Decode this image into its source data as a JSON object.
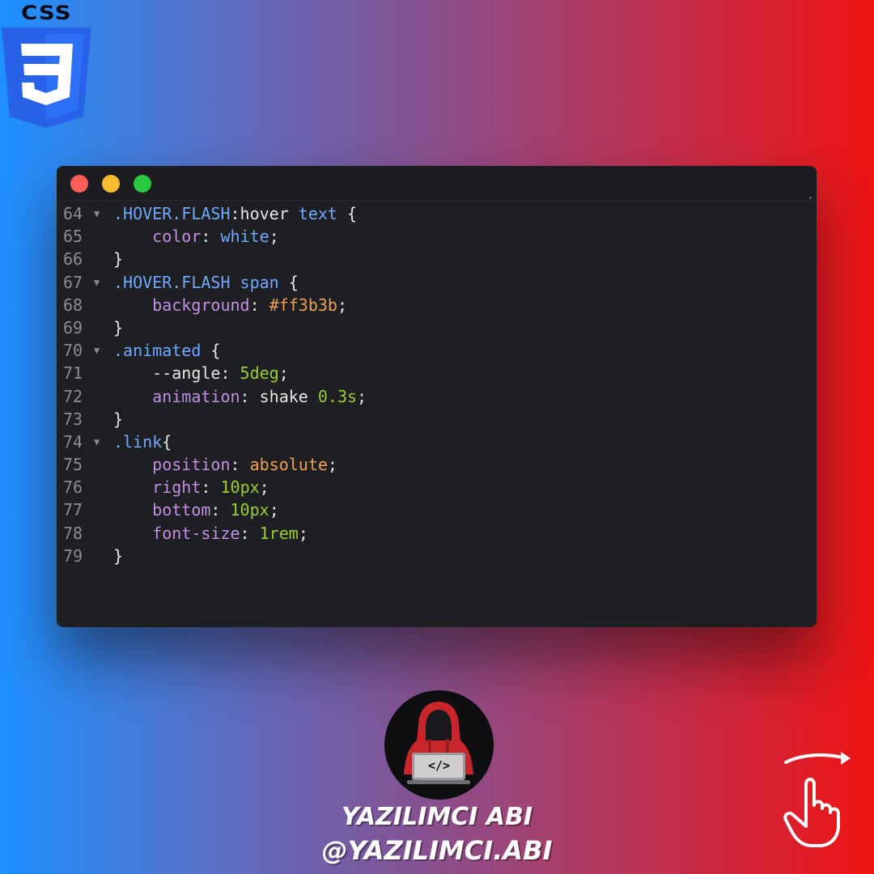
{
  "logo": {
    "word": "CSS",
    "digit": "3"
  },
  "window": {
    "controls": [
      "close",
      "minimize",
      "maximize"
    ],
    "lines": [
      {
        "num": "64",
        "fold": true,
        "tokens": [
          [
            "sel",
            ".HOVER.FLASH"
          ],
          [
            "pseudo",
            ":hover"
          ],
          [
            "plain",
            " "
          ],
          [
            "sel",
            "text"
          ],
          [
            "plain",
            " {"
          ]
        ]
      },
      {
        "num": "65",
        "fold": false,
        "tokens": [
          [
            "plain",
            "    "
          ],
          [
            "prop",
            "color"
          ],
          [
            "plain",
            ": "
          ],
          [
            "val-kw",
            "white"
          ],
          [
            "plain",
            ";"
          ]
        ]
      },
      {
        "num": "66",
        "fold": false,
        "tokens": [
          [
            "plain",
            "}"
          ]
        ]
      },
      {
        "num": "67",
        "fold": true,
        "tokens": [
          [
            "sel",
            ".HOVER.FLASH"
          ],
          [
            "plain",
            " "
          ],
          [
            "sel",
            "span"
          ],
          [
            "plain",
            " {"
          ]
        ]
      },
      {
        "num": "68",
        "fold": false,
        "tokens": [
          [
            "plain",
            "    "
          ],
          [
            "prop",
            "background"
          ],
          [
            "plain",
            ": "
          ],
          [
            "val-orange",
            "#ff3b3b"
          ],
          [
            "plain",
            ";"
          ]
        ]
      },
      {
        "num": "69",
        "fold": false,
        "tokens": [
          [
            "plain",
            "}"
          ]
        ]
      },
      {
        "num": "70",
        "fold": true,
        "tokens": [
          [
            "sel",
            ".animated"
          ],
          [
            "plain",
            " {"
          ]
        ]
      },
      {
        "num": "71",
        "fold": false,
        "tokens": [
          [
            "plain",
            "    --angle: "
          ],
          [
            "val-green",
            "5deg"
          ],
          [
            "plain",
            ";"
          ]
        ]
      },
      {
        "num": "72",
        "fold": false,
        "tokens": [
          [
            "plain",
            "    "
          ],
          [
            "prop",
            "animation"
          ],
          [
            "plain",
            ": shake "
          ],
          [
            "val-green",
            "0.3s"
          ],
          [
            "plain",
            ";"
          ]
        ]
      },
      {
        "num": "73",
        "fold": false,
        "tokens": [
          [
            "plain",
            "}"
          ]
        ]
      },
      {
        "num": "74",
        "fold": true,
        "tokens": [
          [
            "sel",
            ".link"
          ],
          [
            "plain",
            "{"
          ]
        ]
      },
      {
        "num": "75",
        "fold": false,
        "tokens": [
          [
            "plain",
            "    "
          ],
          [
            "prop",
            "position"
          ],
          [
            "plain",
            ": "
          ],
          [
            "val-orange",
            "absolute"
          ],
          [
            "plain",
            ";"
          ]
        ]
      },
      {
        "num": "76",
        "fold": false,
        "tokens": [
          [
            "plain",
            "    "
          ],
          [
            "prop",
            "right"
          ],
          [
            "plain",
            ": "
          ],
          [
            "val-green",
            "10px"
          ],
          [
            "plain",
            ";"
          ]
        ]
      },
      {
        "num": "77",
        "fold": false,
        "tokens": [
          [
            "plain",
            "    "
          ],
          [
            "prop",
            "bottom"
          ],
          [
            "plain",
            ": "
          ],
          [
            "val-green",
            "10px"
          ],
          [
            "plain",
            ";"
          ]
        ]
      },
      {
        "num": "78",
        "fold": false,
        "tokens": [
          [
            "plain",
            "    "
          ],
          [
            "prop",
            "font-size"
          ],
          [
            "plain",
            ": "
          ],
          [
            "val-green",
            "1rem"
          ],
          [
            "plain",
            ";"
          ]
        ]
      },
      {
        "num": "79",
        "fold": false,
        "tokens": [
          [
            "plain",
            "}"
          ]
        ]
      }
    ]
  },
  "avatar": {
    "laptop_label": "</>",
    "icon": "hooded-hacker-icon"
  },
  "brand": {
    "name": "YAZILIMCI ABI",
    "handle": "@YAZILIMCI.ABI"
  },
  "swipe": {
    "icon": "swipe-hand-icon"
  }
}
